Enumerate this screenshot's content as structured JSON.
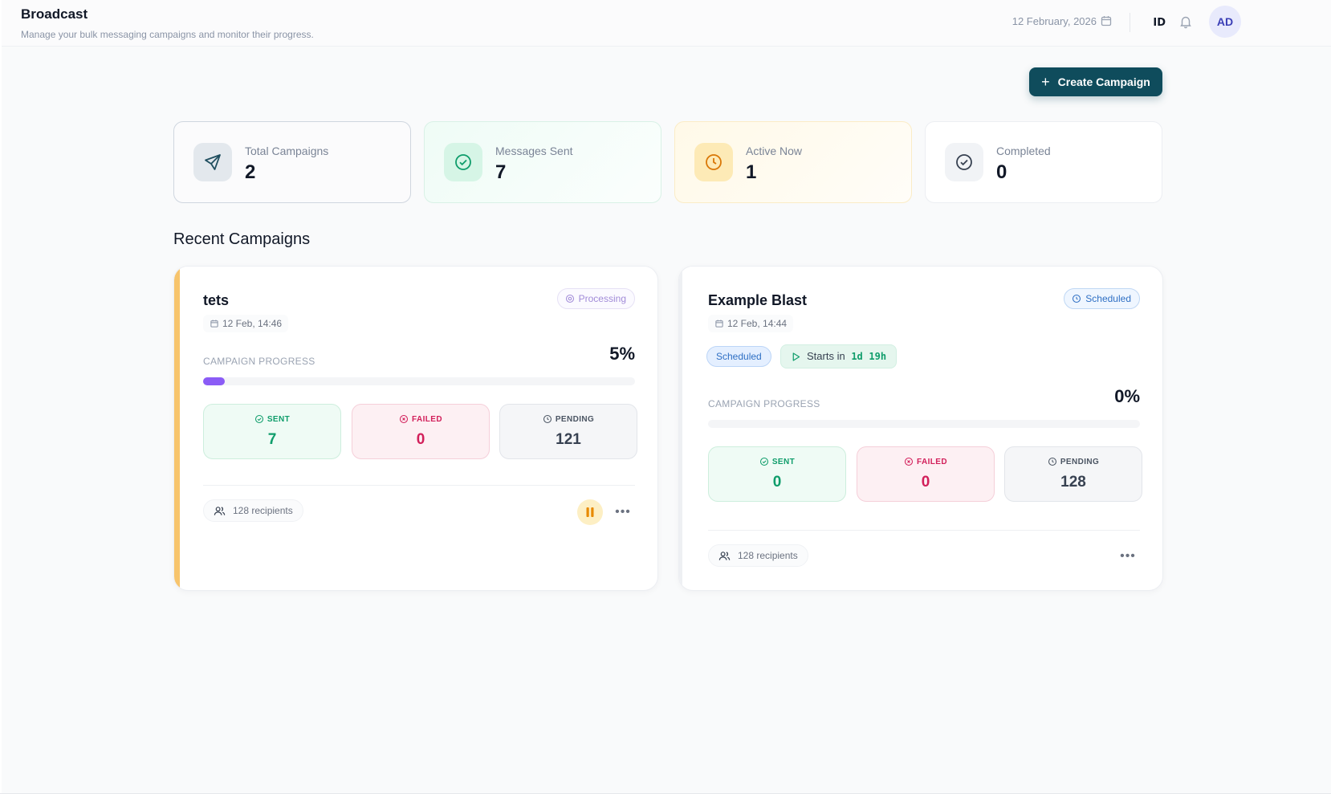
{
  "header": {
    "title": "Broadcast",
    "subtitle": "Manage your bulk messaging campaigns and monitor their progress.",
    "date": "12 February, 2026",
    "language": "ID",
    "avatar_initials": "AD"
  },
  "actions": {
    "create_campaign_label": "Create Campaign"
  },
  "stats": [
    {
      "label": "Total Campaigns",
      "value": "2",
      "icon": "send-icon"
    },
    {
      "label": "Messages Sent",
      "value": "7",
      "icon": "check-circle-icon"
    },
    {
      "label": "Active Now",
      "value": "1",
      "icon": "clock-icon"
    },
    {
      "label": "Completed",
      "value": "0",
      "icon": "check-circle-icon"
    }
  ],
  "section_title": "Recent Campaigns",
  "campaigns": [
    {
      "name": "tets",
      "date": "12 Feb, 14:46",
      "status": "Processing",
      "progress_label": "CAMPAIGN PROGRESS",
      "progress_text": "5%",
      "progress": 5,
      "sent_label": "SENT",
      "sent": "7",
      "failed_label": "FAILED",
      "failed": "0",
      "pending_label": "PENDING",
      "pending": "121",
      "recipients": "128 recipients"
    },
    {
      "name": "Example Blast",
      "date": "12 Feb, 14:44",
      "status": "Scheduled",
      "scheduled_pill": "Scheduled",
      "starts_in_label": "Starts in",
      "starts_in_days": "1d",
      "starts_in_hours": "19h",
      "progress_label": "CAMPAIGN PROGRESS",
      "progress_text": "0%",
      "progress": 0,
      "sent_label": "SENT",
      "sent": "0",
      "failed_label": "FAILED",
      "failed": "0",
      "pending_label": "PENDING",
      "pending": "128",
      "recipients": "128 recipients"
    }
  ],
  "colors": {
    "primary": "#0f4c5c",
    "accent_processing": "#f7c46c",
    "progress_fill": "#8b5cf6",
    "sent": "#0f9d6b",
    "failed": "#d21f5a"
  }
}
